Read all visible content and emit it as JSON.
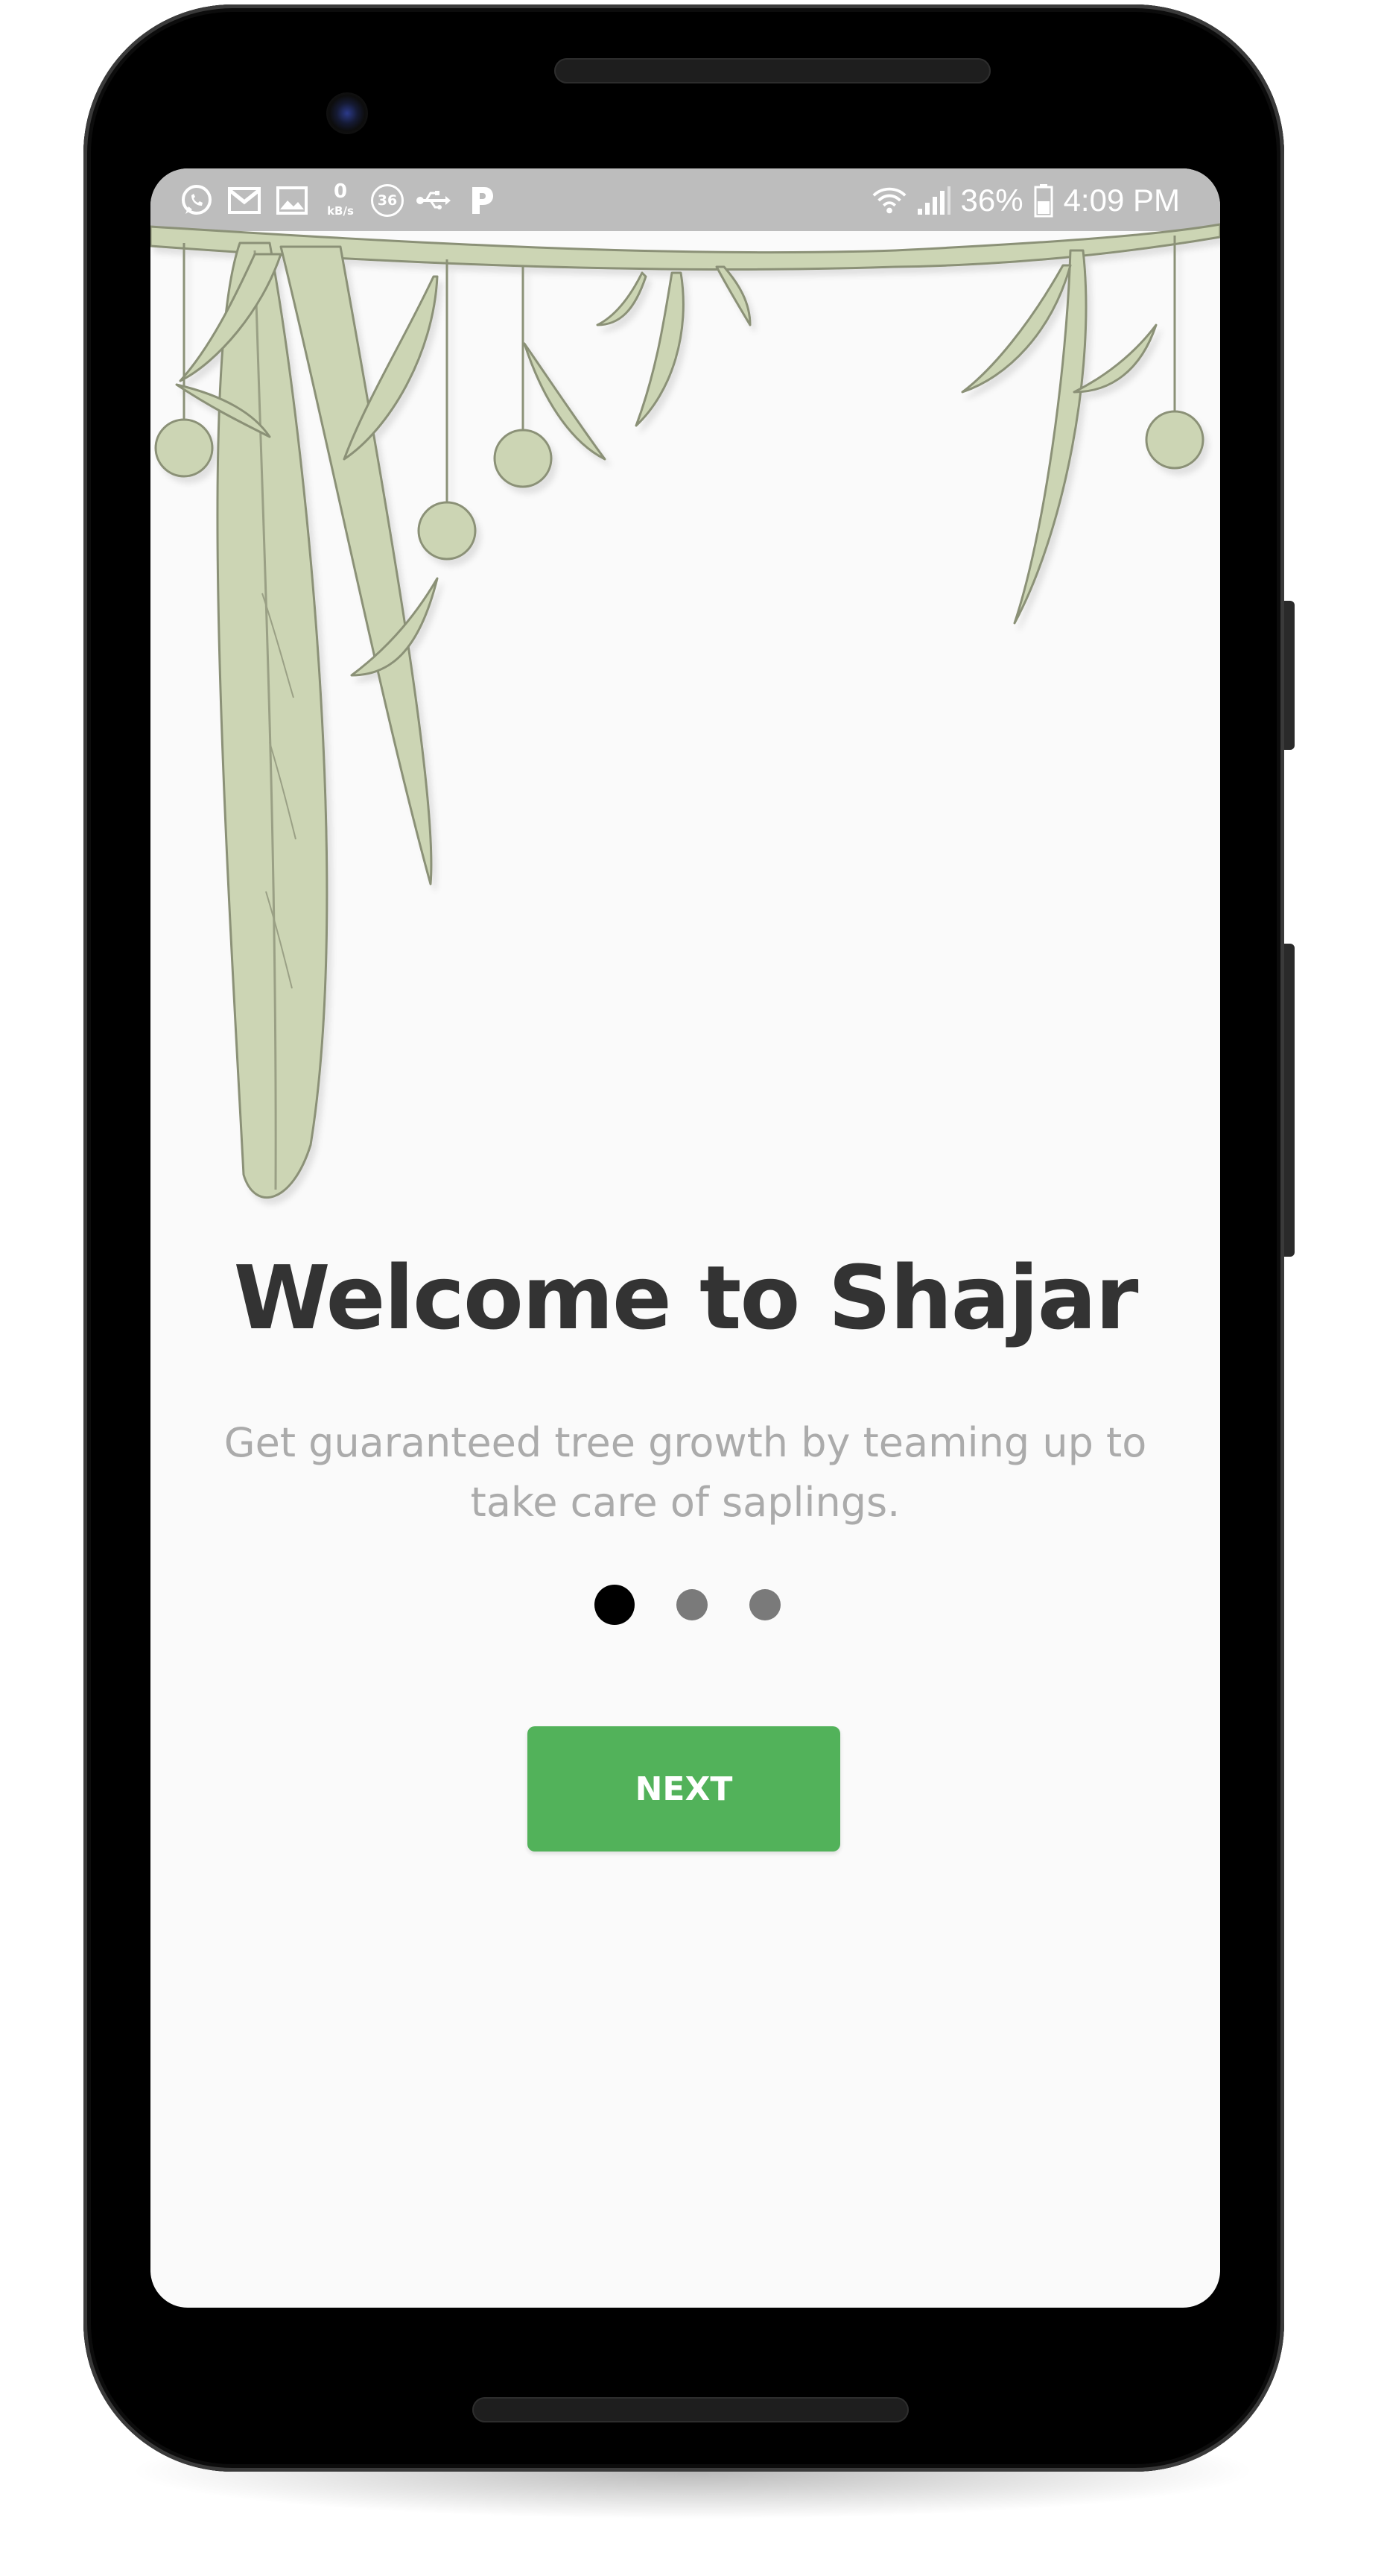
{
  "status_bar": {
    "net_speed_value": "0",
    "net_speed_unit": "kB/s",
    "notification_badge": "36",
    "battery_percent": "36%",
    "time": "4:09 PM",
    "left_icons": [
      "whatsapp-icon",
      "gmail-icon",
      "gallery-icon",
      "net-speed-indicator",
      "badge-36-icon",
      "usb-icon",
      "paytm-icon"
    ],
    "right_icons": [
      "wifi-icon",
      "signal-icon",
      "battery-icon"
    ]
  },
  "onboarding": {
    "title": "Welcome to Shajar",
    "subtitle": "Get guaranteed tree growth by teaming up to take care of saplings.",
    "page_count": 3,
    "active_page": 1,
    "next_label": "NEXT"
  },
  "colors": {
    "accent_button": "#52b25a",
    "leaf_fill": "#ccd5b4",
    "leaf_stroke": "#8b9177",
    "title_text": "#333333",
    "subtitle_text": "#ababab",
    "dot_active": "#000000",
    "dot_inactive": "#7a7a7a",
    "status_bar": "#bdbdbd"
  }
}
